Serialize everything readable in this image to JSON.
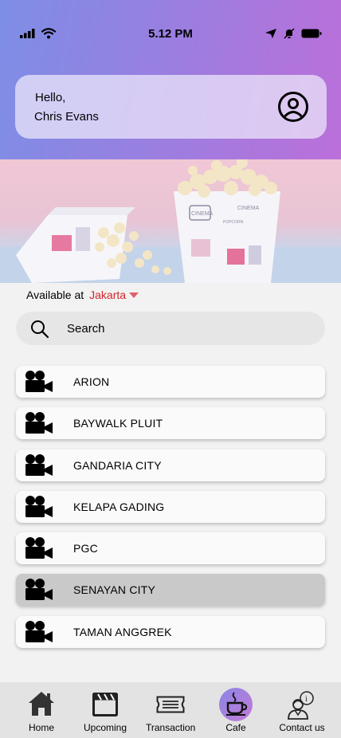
{
  "status_bar": {
    "time": "5.12 PM"
  },
  "greeting": {
    "line1": "Hello,",
    "line2": "Chris Evans"
  },
  "location": {
    "prefix": "Available at",
    "city": "Jakarta"
  },
  "search": {
    "placeholder": "Search"
  },
  "cinemas": [
    {
      "name": "ARION"
    },
    {
      "name": "BAYWALK PLUIT"
    },
    {
      "name": "GANDARIA CITY"
    },
    {
      "name": "KELAPA GADING"
    },
    {
      "name": "PGC"
    },
    {
      "name": "SENAYAN CITY",
      "selected": true
    },
    {
      "name": "TAMAN ANGGREK"
    }
  ],
  "nav": {
    "home": "Home",
    "upcoming": "Upcoming",
    "transaction": "Transaction",
    "cafe": "Cafe",
    "contact": "Contact us"
  },
  "banner_text": {
    "box_label": "CINEMA",
    "box_sub": "POPCORN"
  },
  "colors": {
    "header_start": "#7d8ee6",
    "header_end": "#bb6fd9",
    "city": "#d6232b",
    "selected_row": "#c9c9c9"
  },
  "icons": [
    "signal-icon",
    "wifi-icon",
    "location-arrow-icon",
    "mute-icon",
    "battery-icon",
    "profile-icon",
    "search-icon",
    "movie-camera-icon",
    "home-icon",
    "clapperboard-icon",
    "ticket-icon",
    "coffee-cup-icon",
    "support-agent-icon"
  ]
}
